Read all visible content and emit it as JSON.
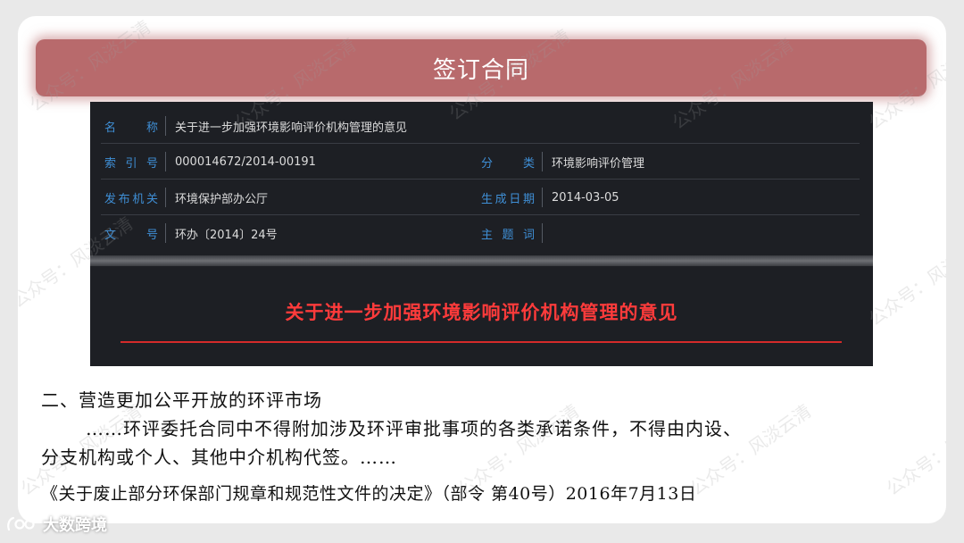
{
  "slide": {
    "title": "签订合同"
  },
  "document": {
    "rows": [
      {
        "label": "名　称",
        "value": "关于进一步加强环境影响评价机构管理的意见"
      },
      {
        "label": "索引号",
        "value": "000014672/2014-00191",
        "label2": "分　类",
        "value2": "环境影响评价管理"
      },
      {
        "label": "发布机关",
        "value": "环境保护部办公厅",
        "label2": "生成日期",
        "value2": "2014-03-05"
      },
      {
        "label": "文　号",
        "value": "环办〔2014〕24号",
        "label2": "主题词",
        "value2": ""
      }
    ],
    "heading": "关于进一步加强环境影响评价机构管理的意见",
    "colors": {
      "label": "#3f8fd6",
      "heading": "#ff3b3b",
      "panel_bg": "#1d1f24"
    }
  },
  "body": {
    "line1": "二、营造更加公平开放的环评市场",
    "line2": "……环评委托合同中不得附加涉及环评审批事项的各类承诺条件，不得由内设、",
    "line3": "分支机构或个人、其他中介机构代签。……",
    "line4": "《关于废止部分环保部门规章和规范性文件的决定》（部令 第40号）2016年7月13日"
  },
  "watermark": {
    "text": "公众号：风淡云清"
  },
  "logo": {
    "text": "大数跨境",
    "icon": "logo-icon"
  },
  "colors": {
    "title_bar": "#b86a6c"
  }
}
